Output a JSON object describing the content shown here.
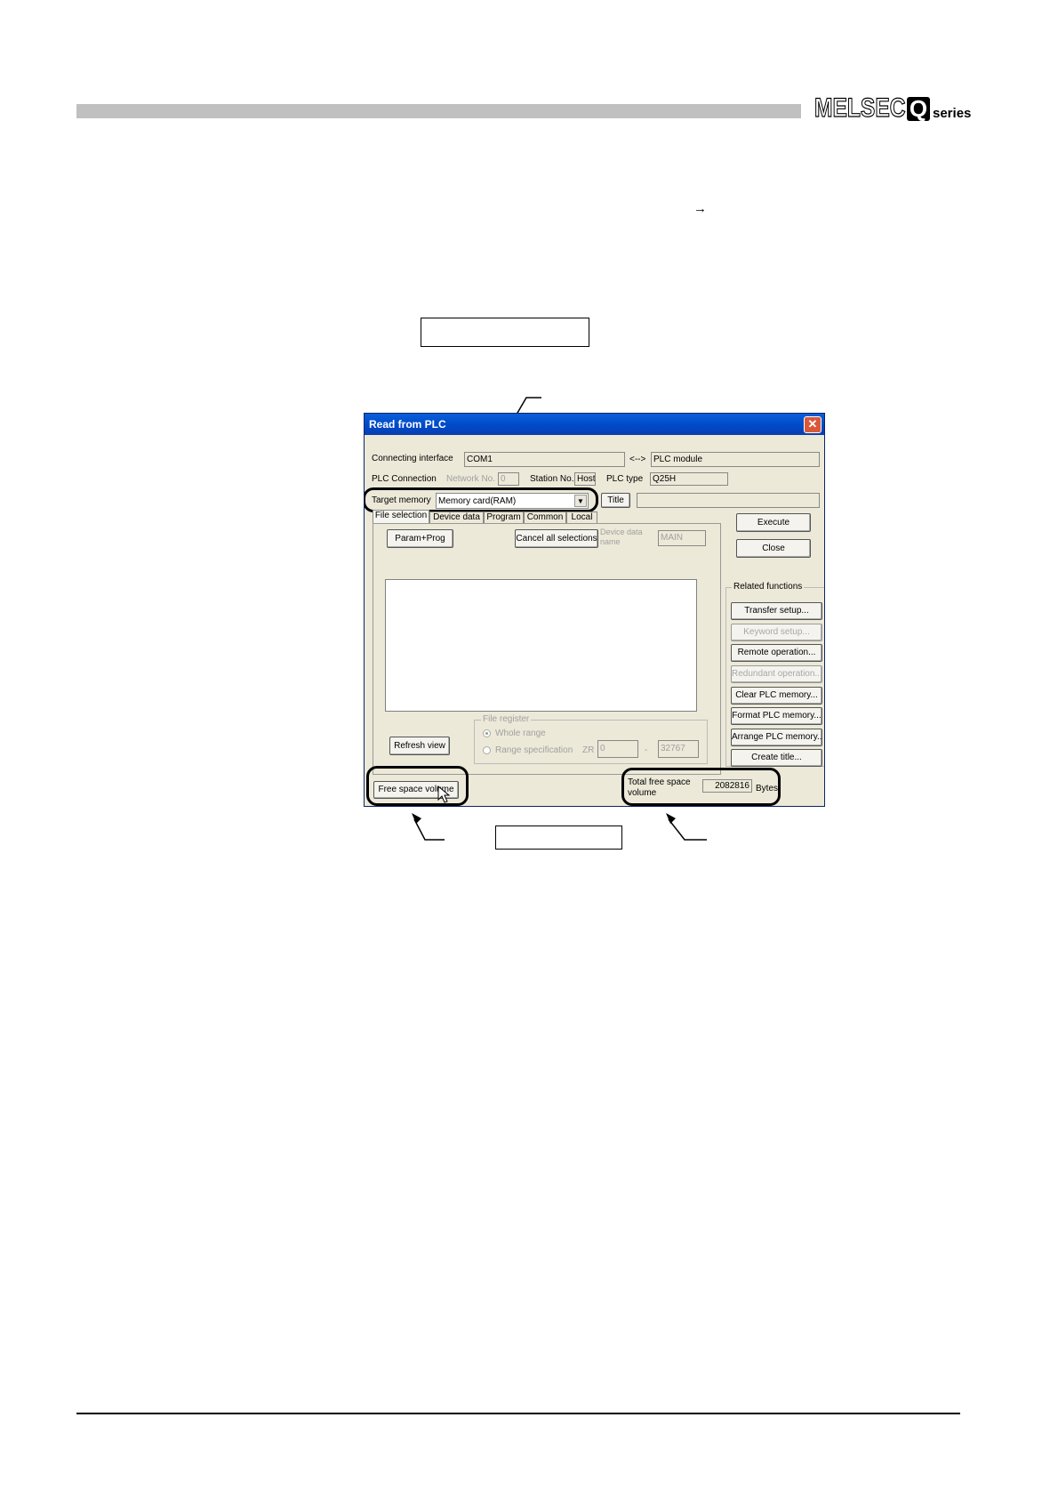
{
  "header": {
    "brand_melsec": "MELSEC",
    "brand_q": "Q",
    "brand_series": "series"
  },
  "annotation": {
    "arrow_glyph": "→"
  },
  "dialog": {
    "title": "Read from PLC",
    "connecting_interface_label": "Connecting interface",
    "connecting_interface_value": "COM1",
    "link_symbol": "<-->",
    "connection_target_value": "PLC module",
    "plc_connection_label": "PLC Connection",
    "network_no_label": "Network No.",
    "network_no_value": "0",
    "station_no_label": "Station No.",
    "station_no_value": "Host",
    "plc_type_label": "PLC type",
    "plc_type_value": "Q25H",
    "target_memory_label": "Target memory",
    "target_memory_value": "Memory card(RAM)",
    "title_button": "Title",
    "title_value": "",
    "tabs": [
      "File selection",
      "Device data",
      "Program",
      "Common",
      "Local"
    ],
    "param_prog_button": "Param+Prog",
    "cancel_all_button": "Cancel all selections",
    "device_data_name_label": "Device data name",
    "device_data_name_value": "MAIN",
    "refresh_view_button": "Refresh view",
    "file_register_label": "File register",
    "whole_range_label": "Whole range",
    "range_spec_label": "Range specification",
    "zr_label": "ZR",
    "range_start": "0",
    "range_dash": "-",
    "range_end": "32767",
    "execute_button": "Execute",
    "close_button": "Close",
    "related_functions_label": "Related functions",
    "related_buttons": [
      {
        "label": "Transfer setup...",
        "enabled": true
      },
      {
        "label": "Keyword setup...",
        "enabled": false
      },
      {
        "label": "Remote operation...",
        "enabled": true
      },
      {
        "label": "Redundant operation...",
        "enabled": false
      },
      {
        "label": "Clear PLC memory...",
        "enabled": true
      },
      {
        "label": "Format PLC memory...",
        "enabled": true
      },
      {
        "label": "Arrange PLC memory...",
        "enabled": true
      },
      {
        "label": "Create title...",
        "enabled": true
      }
    ],
    "free_space_button": "Free space volume",
    "total_free_label_1": "Total free space",
    "total_free_label_2": "volume",
    "total_free_value": "2082816",
    "total_free_unit": "Bytes"
  },
  "colors": {
    "titlebar": "#0054e3",
    "dialog_bg": "#ece9d8",
    "header_bar": "#c0c0c0"
  }
}
